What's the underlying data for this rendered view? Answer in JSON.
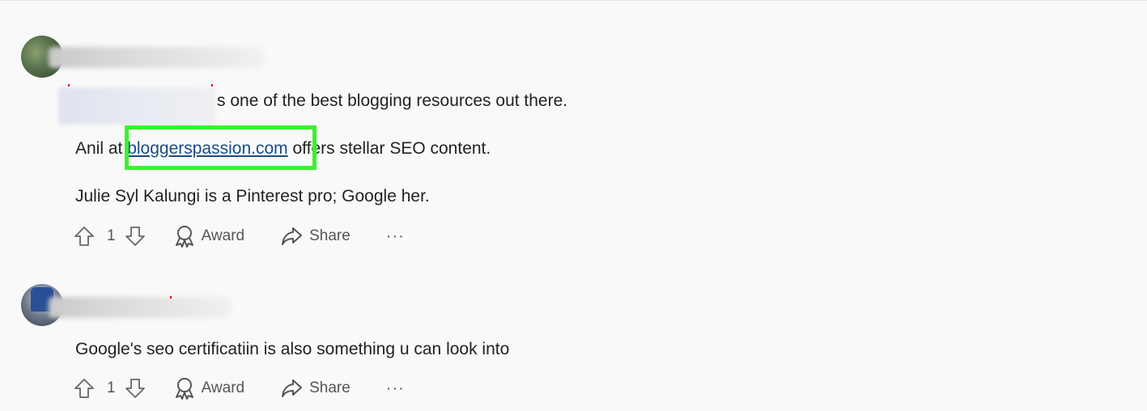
{
  "comments": [
    {
      "paragraphs": [
        "s one of the best blogging resources out there.",
        "Julie Syl Kalungi is a Pinterest pro; Google her."
      ],
      "link_line": {
        "prefix": "Anil at ",
        "link_text": "bloggerspassion.com",
        "suffix": " offers stellar SEO content."
      },
      "votes": "1",
      "award_label": "Award",
      "share_label": "Share",
      "more_label": "···"
    },
    {
      "paragraphs": [
        "Google's seo certificatiin is also something u can look into"
      ],
      "votes": "1",
      "award_label": "Award",
      "share_label": "Share",
      "more_label": "···"
    }
  ],
  "icons": {
    "upvote": "arrow-up-icon",
    "downvote": "arrow-down-icon",
    "award": "award-ribbon-icon",
    "share": "share-arrow-icon",
    "more": "more-dots-icon"
  },
  "colors": {
    "highlight": "#3af22b",
    "link": "#1b4c84",
    "background": "#f9f9f9"
  }
}
